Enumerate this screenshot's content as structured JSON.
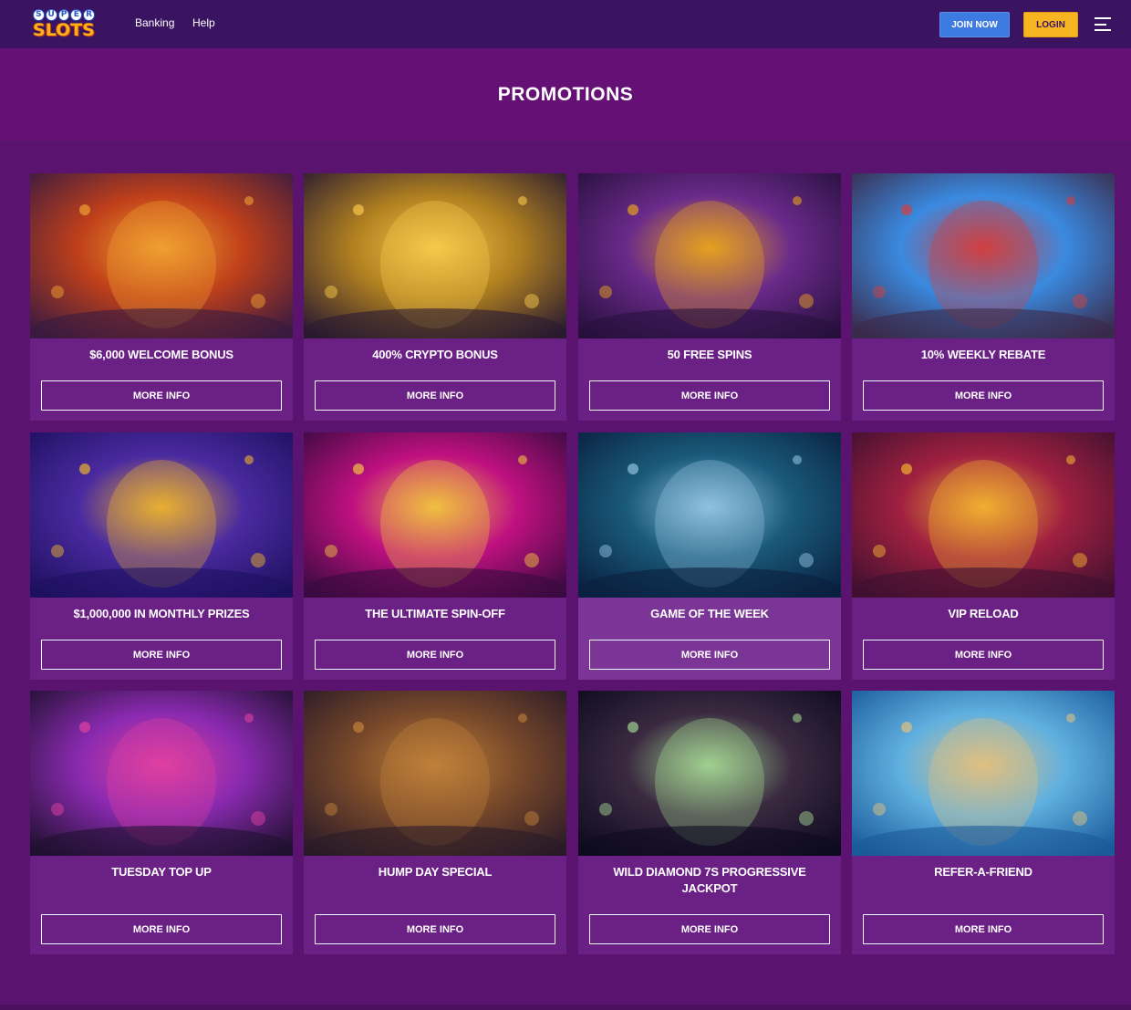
{
  "header": {
    "logo_top": [
      "S",
      "U",
      "P",
      "E",
      "R"
    ],
    "logo_bottom": "SLOTS",
    "nav": [
      "Banking",
      "Help"
    ],
    "join_label": "JOIN NOW",
    "login_label": "LOGIN"
  },
  "page_title": "PROMOTIONS",
  "more_label": "MORE INFO",
  "promotions": [
    {
      "title": "$6,000 WELCOME BONUS",
      "art": "tiki-mask-icon",
      "colors": [
        "#3a1a40",
        "#c0401a",
        "#f0a030"
      ]
    },
    {
      "title": "400% CRYPTO BONUS",
      "art": "bitcoin-coin-icon",
      "colors": [
        "#2a1a30",
        "#b08020",
        "#f6c84a"
      ]
    },
    {
      "title": "50 FREE SPINS",
      "art": "tiger-icon",
      "colors": [
        "#28103e",
        "#6a2a8a",
        "#e6a020"
      ]
    },
    {
      "title": "10% WEEKLY REBATE",
      "art": "superhero-icon",
      "colors": [
        "#3a2a4a",
        "#3a8ae0",
        "#d04040"
      ]
    },
    {
      "title": "$1,000,000 IN MONTHLY PRIZES",
      "art": "trophy-slot-icon",
      "colors": [
        "#1e1060",
        "#4a2aa0",
        "#e8b030"
      ]
    },
    {
      "title": "THE ULTIMATE SPIN-OFF",
      "art": "golden-reel-icon",
      "colors": [
        "#3a0a40",
        "#c01080",
        "#f0c040"
      ]
    },
    {
      "title": "GAME OF THE WEEK",
      "art": "shark-icon",
      "colors": [
        "#0a2040",
        "#1a5a7a",
        "#90c0e0"
      ]
    },
    {
      "title": "VIP RELOAD",
      "art": "treasure-chest-icon",
      "colors": [
        "#401030",
        "#a02040",
        "#f0b030"
      ]
    },
    {
      "title": "TUESDAY TOP UP",
      "art": "star-slot-icon",
      "colors": [
        "#201030",
        "#8a2ab0",
        "#e040a0"
      ]
    },
    {
      "title": "HUMP DAY SPECIAL",
      "art": "cowboy-icon",
      "colors": [
        "#2a1a28",
        "#7a4a2a",
        "#c0803a"
      ]
    },
    {
      "title": "WILD DIAMOND 7S PROGRESSIVE JACKPOT",
      "art": "card-player-icon",
      "colors": [
        "#0e0a20",
        "#3a2a40",
        "#a0d090"
      ]
    },
    {
      "title": "REFER-A-FRIEND",
      "art": "free-spins-sign-icon",
      "colors": [
        "#1a5a9a",
        "#60b0e0",
        "#e0c080"
      ]
    }
  ]
}
